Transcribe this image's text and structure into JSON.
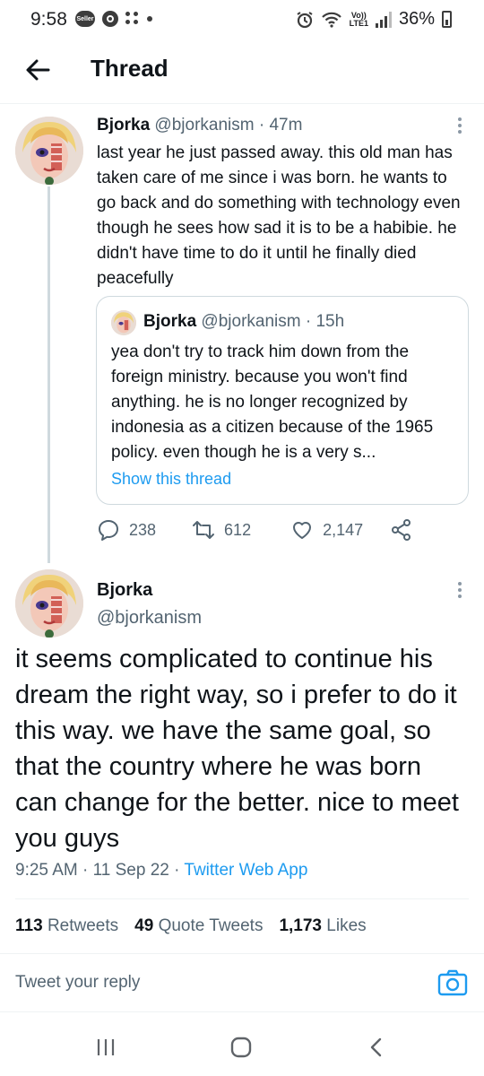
{
  "status_bar": {
    "time": "9:58",
    "pill_text": "Seller",
    "lte_top": "Vo))",
    "lte_bottom": "LTE1",
    "battery": "36%"
  },
  "header": {
    "title": "Thread"
  },
  "thread_tweet": {
    "name": "Bjorka",
    "handle": "@bjorkanism",
    "age": "· 47m",
    "text": "last year he just passed away. this old man has taken care of me since i was born. he wants to go back and do something with technology even though he sees how sad it is to be a habibie. he didn't have time to do it until he finally died peacefully",
    "quote": {
      "name": "Bjorka",
      "handle": "@bjorkanism",
      "age": "· 15h",
      "text": "yea don't try to track him down from the foreign ministry. because you won't find anything. he is no longer recognized by indonesia as a citizen because of the 1965 policy. even though he is a very s...",
      "show_thread": "Show this thread"
    },
    "actions": {
      "replies": "238",
      "retweets": "612",
      "likes": "2,147"
    }
  },
  "main_tweet": {
    "name": "Bjorka",
    "handle": "@bjorkanism",
    "text": "it seems complicated to continue his dream the right way, so i prefer to do it this way. we have the same goal, so that the country where he was born can change for the better. nice to meet you guys",
    "time": "9:25 AM",
    "date": "11 Sep 22",
    "source": "Twitter Web App",
    "stats": {
      "retweets_count": "113",
      "retweets_label": "Retweets",
      "quotes_count": "49",
      "quotes_label": "Quote Tweets",
      "likes_count": "1,173",
      "likes_label": "Likes"
    }
  },
  "reply": {
    "placeholder": "Tweet your reply"
  },
  "colors": {
    "accent": "#1d9bf0",
    "muted": "#536471",
    "border": "#cfd9de"
  }
}
